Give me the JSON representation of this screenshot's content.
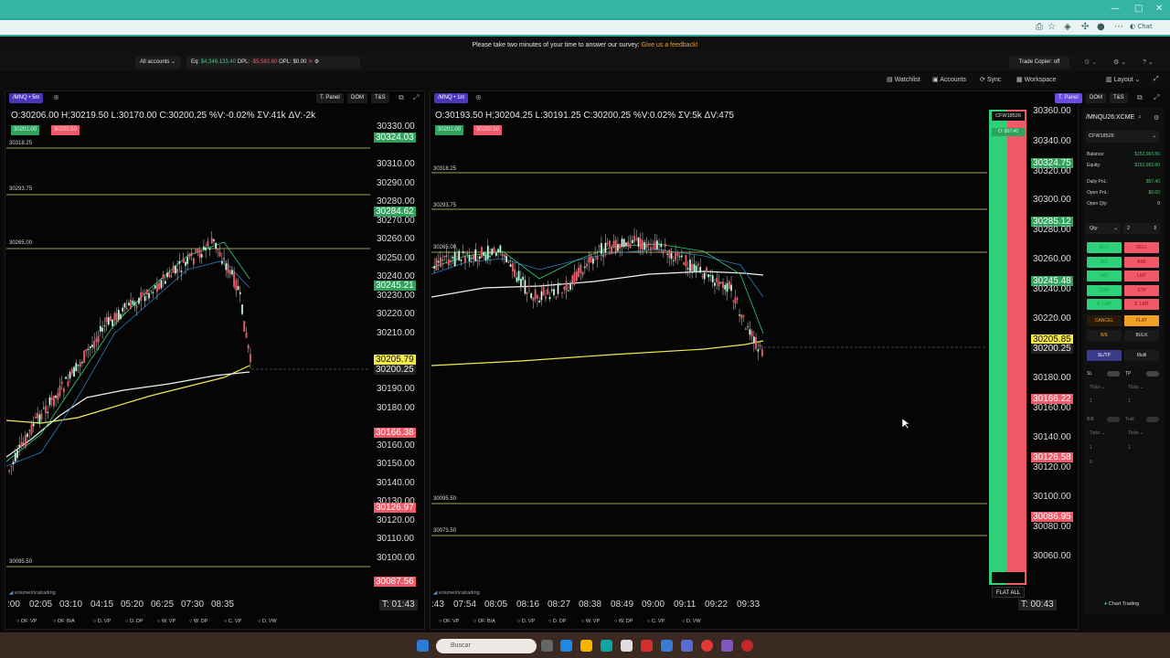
{
  "browser": {
    "window_controls": [
      "—",
      "□",
      "✕"
    ],
    "chat_label": "Chat"
  },
  "survey": {
    "message": "Please take two minutes of your time to answer our survey:",
    "link": "Give us a feedback!"
  },
  "account_bar": {
    "accounts_label": "All accounts",
    "eq_label": "Eq:",
    "eq_value": "$4,346,133.40",
    "dpl_label": "DPL:",
    "dpl_value": "-$5,582.60",
    "opl_label": "OPL:",
    "opl_value": "$0.00",
    "trade_copier": "Trade Copier: off"
  },
  "toolbar": {
    "watchlist": "Watchlist",
    "accounts": "Accounts",
    "sync": "Sync",
    "workspace": "Workspace",
    "layout": "Layout"
  },
  "left_chart": {
    "symbol": "/MNQ • 5m",
    "btn_tpanel": "T. Panel",
    "btn_dom": "DOM",
    "btn_ts": "T&S",
    "ohlc": "O:30206.00  H:30219.50  L:30170.00  C:30200.25  %V:-0.02%  ΣV:41k  ΔV:-2k",
    "bid_badge": "30201.00",
    "ask_badge": "30200.50",
    "levels": [
      "30318.25",
      "30293.75",
      "30265.00",
      "30095.50"
    ],
    "price_axis": [
      "30330.00",
      "30310.00",
      "30290.00",
      "30280.00",
      "30270.00",
      "30260.00",
      "30250.00",
      "30240.00",
      "30230.00",
      "30220.00",
      "30210.00",
      "30190.00",
      "30180.00",
      "30170.00",
      "30160.00",
      "30150.00",
      "30140.00",
      "30130.00",
      "30120.00",
      "30110.00",
      "30100.00",
      "30090.00"
    ],
    "tags": {
      "t1": "30324.03",
      "t2": "30284.62",
      "t3": "30245.21",
      "t4": "30205.79",
      "t5": "30200.25",
      "t6": "30166.38",
      "t7": "30126.97",
      "t8": "30087.56"
    },
    "time_axis": [
      ":00",
      "02:05",
      "03:10",
      "04:15",
      "05:20",
      "06:25",
      "07:30",
      "08:35"
    ],
    "timer": "T: 01:43",
    "watermark": "volumetricatrading",
    "bottom_tabs": [
      "OF. VP",
      "OF. B/A",
      "D. VP",
      "D. DP",
      "W. VP",
      "W. DP",
      "C. VP",
      "D. VW"
    ]
  },
  "right_chart": {
    "symbol": "/MNQ • 1m",
    "btn_tpanel": "T. Panel",
    "btn_dom": "DOM",
    "btn_ts": "T&S",
    "ohlc": "O:30193.50  H:30204.25  L:30191.25  C:30200.25  %V:0.02%  ΣV:5k  ΔV:475",
    "bid_badge": "30201.00",
    "ask_badge": "30200.50",
    "levels": [
      "30318.25",
      "30293.75",
      "30265.00",
      "30095.50",
      "30073.50"
    ],
    "price_axis": [
      "30360.00",
      "30340.00",
      "30320.00",
      "30300.00",
      "30280.00",
      "30260.00",
      "30240.00",
      "30220.00",
      "30200.00",
      "30180.00",
      "30160.00",
      "30140.00",
      "30120.00",
      "30100.00",
      "30080.00",
      "30060.00"
    ],
    "tags": {
      "t1": "30324.75",
      "t2": "30285.12",
      "t3": "30245.48",
      "t4": "30205.85",
      "t5": "30200.25",
      "t6": "30166.22",
      "t7": "30126.58",
      "t8": "30086.95"
    },
    "time_axis": [
      ":43",
      "07:54",
      "08:05",
      "08:16",
      "08:27",
      "08:38",
      "08:49",
      "09:00",
      "09:11",
      "09:22",
      "09:33"
    ],
    "timer": "T: 00:43",
    "watermark": "volumetricatrading",
    "dom_account": "CFW18526",
    "dom_pnl": "O: $57.40",
    "flat_all": "FLAT ALL",
    "bottom_tabs": [
      "OF. VP",
      "OF. B/A",
      "D. VP",
      "D. DP",
      "W. VP",
      "W. DP",
      "C. VP",
      "D. VW"
    ]
  },
  "trade_panel": {
    "symbol": "/MNQU26:XCME",
    "account": "CFW18526",
    "rows": [
      {
        "label": "Balance:",
        "value": "$152,963.80"
      },
      {
        "label": "Equity:",
        "value": "$152,963.80"
      },
      {
        "label": "Daily PnL:",
        "value": "$57.40"
      },
      {
        "label": "Open PnL:",
        "value": "$0.00"
      },
      {
        "label": "Open Qty:",
        "value": "0"
      }
    ],
    "qty_label": "Qty",
    "qty_value": "2",
    "buy": "BUY",
    "sell": "SELL",
    "bid": "BID",
    "ask": "ASK",
    "lmt": "LMT",
    "stp": "STP",
    "slmt": "S. LMT",
    "cancel": "CANCEL",
    "flat": "FLAT",
    "be": "B/E",
    "bulk": "BULK",
    "sltp": "SL/TP",
    "multi": "Multi",
    "sl": "SL",
    "tp": "TP",
    "ticks": "Ticks",
    "tick_val": "1",
    "be2": "B/E",
    "trail": "Trail",
    "zero": "0",
    "chart_trading": "Chart Trading"
  },
  "taskbar": {
    "search_placeholder": "Buscar"
  },
  "colors": {
    "green": "#2fd07a",
    "red": "#f05a68",
    "yellow": "#f4e84a",
    "purple": "#4a36b8",
    "teal": "#2aa89a"
  }
}
